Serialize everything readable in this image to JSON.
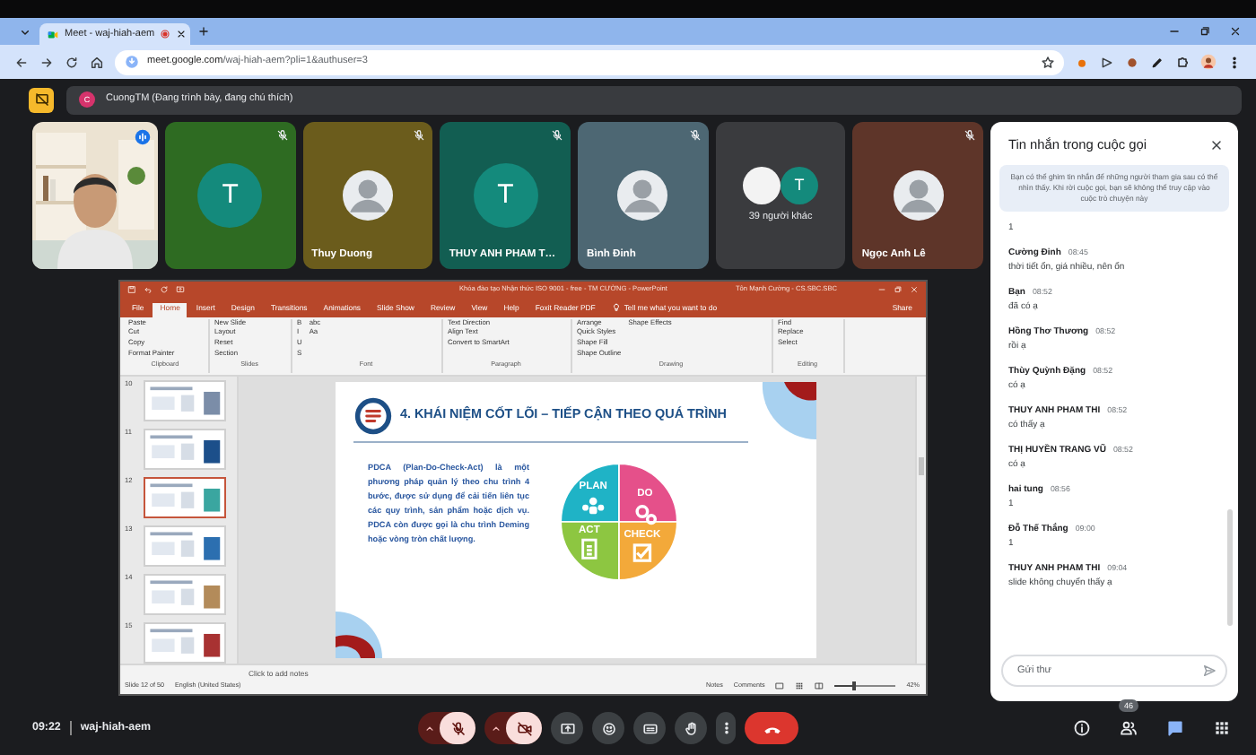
{
  "browser": {
    "tab_title": "Meet - waj-hiah-aem",
    "url_host": "meet.google.com",
    "url_path": "/waj-hiah-aem?pli=1&authuser=3"
  },
  "presenter_banner": {
    "avatar": "C",
    "text": "CuongTM (Đang trình bày, đang chú thích)"
  },
  "tiles": [
    {
      "kind": "video",
      "speaking": true
    },
    {
      "kind": "letter",
      "avatar": "T",
      "color": "#2e6b22",
      "muted": true
    },
    {
      "name": "Thuy Duong",
      "color": "#6b5c1c",
      "muted": true
    },
    {
      "kind": "letter",
      "avatar": "T",
      "name": "THUY ANH PHAM T…",
      "color": "#125e52",
      "muted": true
    },
    {
      "name": "Bình Đinh",
      "color": "#4d6773",
      "muted": true
    },
    {
      "kind": "others",
      "avatar": "T",
      "name": "39 người khác",
      "color": "#3a3b3e"
    },
    {
      "name": "Ngọc Anh Lê",
      "color": "#5e3529",
      "muted": true
    }
  ],
  "presentation": {
    "title": "Khóa đào tạo Nhận thức ISO 9001 - free - TM CƯỜNG - PowerPoint",
    "user": "Tôn Mạnh Cường - CS.SBC.SBC",
    "tabs": [
      {
        "label": "File",
        "selected": false
      },
      {
        "label": "Home",
        "selected": true
      },
      {
        "label": "Insert",
        "selected": false
      },
      {
        "label": "Design",
        "selected": false
      },
      {
        "label": "Transitions",
        "selected": false
      },
      {
        "label": "Animations",
        "selected": false
      },
      {
        "label": "Slide Show",
        "selected": false
      },
      {
        "label": "Review",
        "selected": false
      },
      {
        "label": "View",
        "selected": false
      },
      {
        "label": "Help",
        "selected": false
      },
      {
        "label": "Foxit Reader PDF",
        "selected": false
      }
    ],
    "tell_me": "Tell me what you want to do",
    "share": "Share",
    "ribbon_groups": [
      {
        "label": "Clipboard",
        "items": [
          "Paste",
          "Cut",
          "Copy",
          "Format Painter"
        ]
      },
      {
        "label": "Slides",
        "items": [
          "New Slide",
          "Layout",
          "Reset",
          "Section"
        ]
      },
      {
        "label": "Font",
        "items": [
          "B",
          "I",
          "U",
          "S",
          "abc",
          "Aa"
        ]
      },
      {
        "label": "Paragraph",
        "items": [
          "Text Direction",
          "Align Text",
          "Convert to SmartArt"
        ]
      },
      {
        "label": "Drawing",
        "items": [
          "Arrange",
          "Quick Styles",
          "Shape Fill",
          "Shape Outline",
          "Shape Effects"
        ]
      },
      {
        "label": "Editing",
        "items": [
          "Find",
          "Replace",
          "Select"
        ]
      }
    ],
    "thumbnails": [
      {
        "number": "10",
        "selected": false
      },
      {
        "number": "11",
        "selected": false
      },
      {
        "number": "12",
        "selected": true
      },
      {
        "number": "13",
        "selected": false
      },
      {
        "number": "14",
        "selected": false
      },
      {
        "number": "15",
        "selected": false
      }
    ],
    "slide": {
      "title": "4. KHÁI NIỆM CỐT LÕI – TIẾP CẬN THEO QUÁ TRÌNH",
      "paragraph": "PDCA (Plan-Do-Check-Act) là một phương pháp quản lý theo chu trình 4 bước, được sử dụng để cải tiến liên tục các quy trình, sản phẩm hoặc dịch vụ. PDCA còn được gọi là chu trình Deming hoặc vòng tròn chất lượng.",
      "wheel": [
        {
          "label": "PLAN",
          "color": "#1fb3c6"
        },
        {
          "label": "DO",
          "color": "#e5508a"
        },
        {
          "label": "ACT",
          "color": "#8dc641"
        },
        {
          "label": "CHECK",
          "color": "#f3a93a"
        }
      ]
    },
    "notes": "Click to add notes",
    "status": {
      "slide": "Slide 12 of 50",
      "language": "English (United States)",
      "notes": "Notes",
      "comments": "Comments",
      "zoom": {
        "level": 0.3
      },
      "zoom_text": "42%"
    }
  },
  "chat": {
    "title": "Tin nhắn trong cuộc gọi",
    "notice": "Bạn có thể ghim tin nhắn để những người tham gia sau có thể nhìn thấy. Khi rời cuộc gọi, bạn sẽ không thể truy cập vào cuộc trò chuyện này",
    "messages": [
      {
        "text": "1"
      },
      {
        "sender": "Cường Đinh",
        "time": "08:45",
        "text": "thời tiết ổn, giá nhiều, nên ổn"
      },
      {
        "sender": "Bạn",
        "time": "08:52",
        "text": "đã có ạ"
      },
      {
        "sender": "Hồng Thơ Thương",
        "time": "08:52",
        "text": "rồi ạ"
      },
      {
        "sender": "Thùy Quỳnh Đặng",
        "time": "08:52",
        "text": "có ạ"
      },
      {
        "sender": "THUY ANH PHAM THI",
        "time": "08:52",
        "text": "có thấy ạ"
      },
      {
        "sender": "THỊ HUYỀN TRANG VŨ",
        "time": "08:52",
        "text": "có ạ"
      },
      {
        "sender": "hai tung",
        "time": "08:56",
        "text": "1"
      },
      {
        "sender": "Đỗ Thế Thắng",
        "time": "09:00",
        "text": "1"
      },
      {
        "sender": "THUY ANH PHAM THI",
        "time": "09:04",
        "text": "slide không chuyển thấy ạ"
      }
    ],
    "placeholder": "Gửi thư"
  },
  "bottom": {
    "time": "09:22",
    "code": "waj-hiah-aem",
    "controls": [
      {
        "kind": "mic",
        "on": false
      },
      {
        "kind": "camera",
        "on": false
      },
      {
        "kind": "present"
      },
      {
        "kind": "reactions"
      },
      {
        "kind": "captions"
      },
      {
        "kind": "raise_hand"
      },
      {
        "kind": "more"
      },
      {
        "kind": "leave"
      }
    ],
    "side": [
      {
        "kind": "info",
        "selected": false
      },
      {
        "kind": "people",
        "badge": "46",
        "selected": false
      },
      {
        "kind": "chat",
        "selected": true
      },
      {
        "kind": "activities",
        "selected": false
      }
    ]
  }
}
